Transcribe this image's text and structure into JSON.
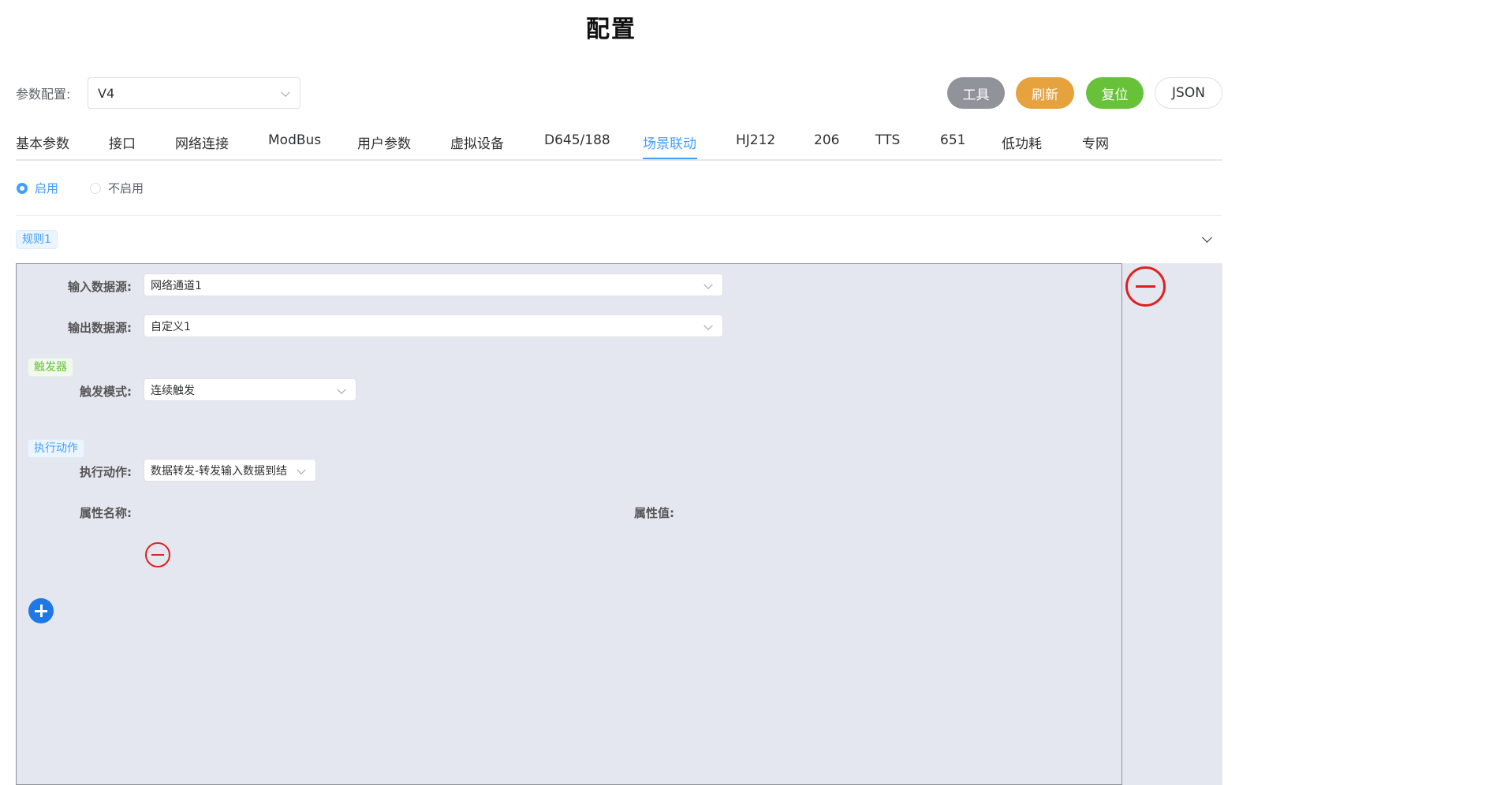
{
  "page": {
    "title": "配置"
  },
  "toolbar": {
    "param_label": "参数配置:",
    "version_value": "V4",
    "tool_label": "工具",
    "refresh_label": "刷新",
    "reset_label": "复位",
    "json_label": "JSON",
    "colors": {
      "tool": "#909399",
      "refresh": "#e6a23c",
      "reset": "#67c23a"
    }
  },
  "tabs": [
    {
      "label": "基本参数"
    },
    {
      "label": "接口"
    },
    {
      "label": "网络连接"
    },
    {
      "label": "ModBus"
    },
    {
      "label": "用户参数"
    },
    {
      "label": "虚拟设备"
    },
    {
      "label": "D645/188"
    },
    {
      "label": "场景联动",
      "active": true
    },
    {
      "label": "HJ212"
    },
    {
      "label": "206"
    },
    {
      "label": "TTS"
    },
    {
      "label": "651"
    },
    {
      "label": "低功耗"
    },
    {
      "label": "专网"
    }
  ],
  "enable": {
    "on_label": "启用",
    "off_label": "不启用",
    "selected": "启用"
  },
  "rule": {
    "tag": "规则1",
    "input_source_label": "输入数据源:",
    "input_source_value": "网络通道1",
    "output_source_label": "输出数据源:",
    "output_source_value": "自定义1",
    "trigger_tag": "触发器",
    "trigger_mode_label": "触发模式:",
    "trigger_mode_value": "连续触发",
    "action_tag": "执行动作",
    "action_label": "执行动作:",
    "action_value": "数据转发-转发输入数据到结",
    "prop_name_label": "属性名称:",
    "prop_value_label": "属性值:"
  },
  "icons": {
    "remove_rule": "minus-circle-icon",
    "remove_prop": "minus-circle-icon",
    "add_prop": "plus-circle-icon",
    "dropdown": "chevron-down-icon"
  },
  "colors": {
    "accent": "#409eff",
    "danger": "#e02020",
    "panel_bg": "#e4e7ef"
  }
}
